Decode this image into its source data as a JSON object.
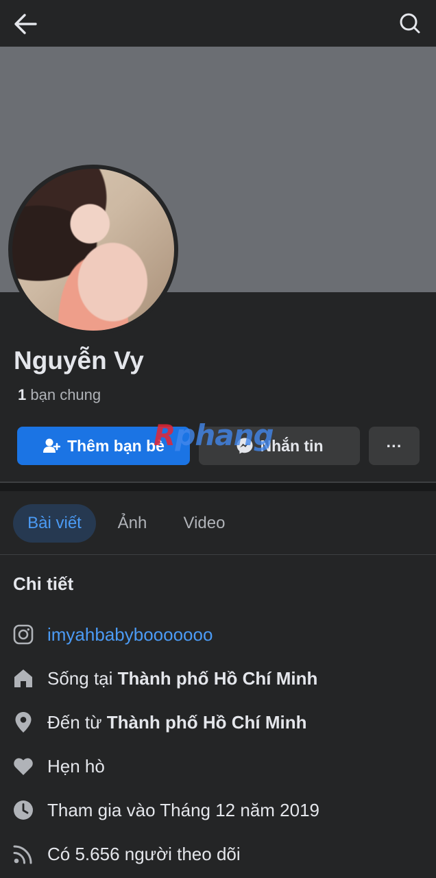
{
  "profile": {
    "name": "Nguyễn Vy",
    "mutual_count": "1",
    "mutual_label": "bạn chung"
  },
  "actions": {
    "add_friend": "Thêm bạn bè",
    "message": "Nhắn tin",
    "more": "···"
  },
  "watermark": {
    "part1": "R",
    "part2": "phang"
  },
  "tabs": [
    {
      "label": "Bài viết",
      "active": true
    },
    {
      "label": "Ảnh",
      "active": false
    },
    {
      "label": "Video",
      "active": false
    }
  ],
  "details": {
    "title": "Chi tiết",
    "instagram": "imyahbabybooooooo",
    "lives_prefix": "Sống tại",
    "lives_place": "Thành phố Hồ Chí Minh",
    "from_prefix": "Đến từ",
    "from_place": "Thành phố Hồ Chí Minh",
    "relationship": "Hẹn hò",
    "joined": "Tham gia vào Tháng 12 năm 2019",
    "followers": "Có 5.656 người theo dõi"
  },
  "icons": {
    "back": "arrow-left-icon",
    "search": "search-icon",
    "add_friend": "add-person-icon",
    "messenger": "messenger-icon",
    "instagram": "instagram-icon",
    "home": "home-icon",
    "location": "location-pin-icon",
    "heart": "heart-icon",
    "clock": "clock-icon",
    "rss": "rss-icon"
  },
  "colors": {
    "background": "#242526",
    "primary": "#1b74e4",
    "link": "#4b9bf5",
    "cover": "#6b6e73"
  }
}
